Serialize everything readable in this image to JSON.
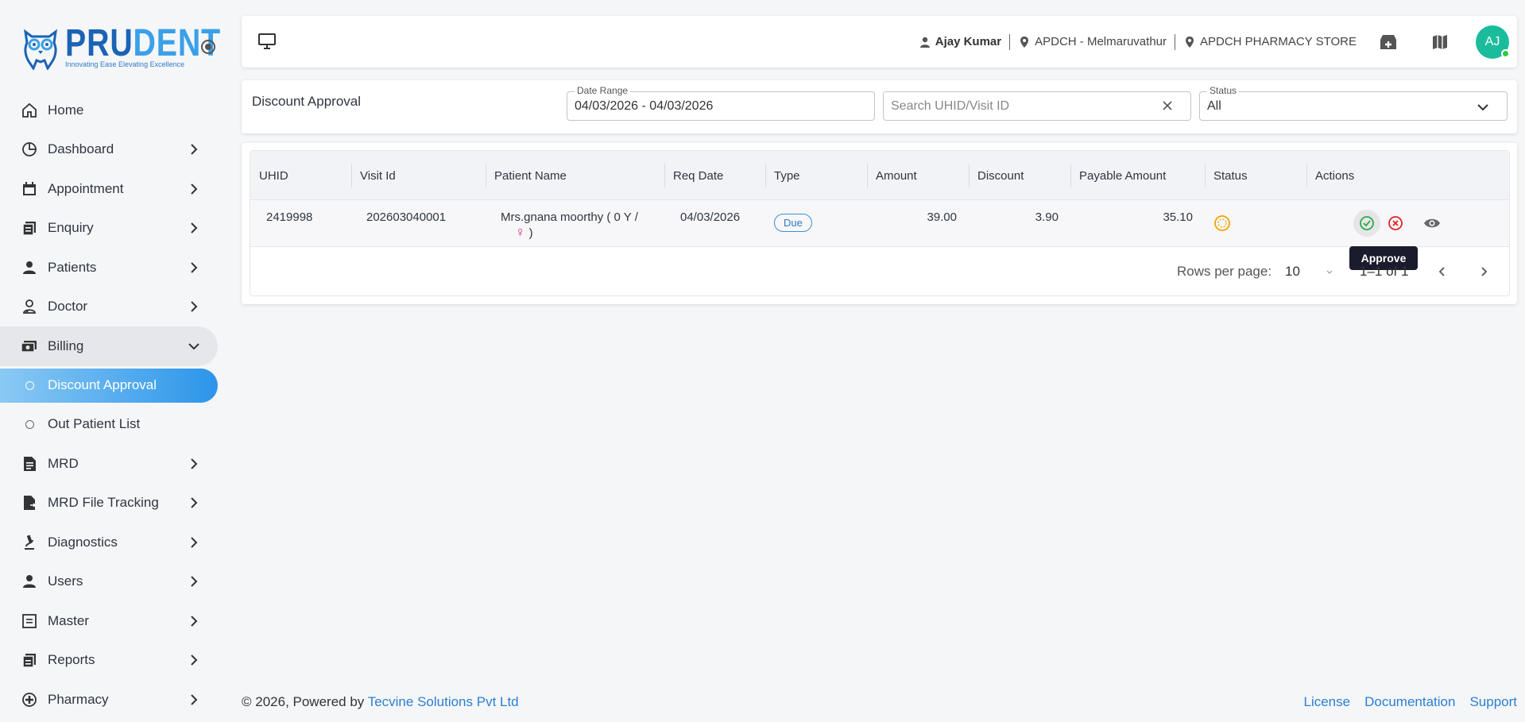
{
  "brand": {
    "part1": "PRU",
    "part2": "DENT",
    "tagline": "Innovating Ease Elevating Excellence"
  },
  "sidebar": {
    "items": [
      {
        "label": "Home",
        "icon": "home-icon"
      },
      {
        "label": "Dashboard",
        "icon": "pie-chart-icon"
      },
      {
        "label": "Appointment",
        "icon": "calendar-icon"
      },
      {
        "label": "Enquiry",
        "icon": "document-stack-icon"
      },
      {
        "label": "Patients",
        "icon": "person-icon"
      },
      {
        "label": "Doctor",
        "icon": "doctor-icon"
      },
      {
        "label": "Billing",
        "icon": "billing-icon"
      },
      {
        "label": "MRD",
        "icon": "file-text-icon"
      },
      {
        "label": "MRD File Tracking",
        "icon": "file-tracking-icon"
      },
      {
        "label": "Diagnostics",
        "icon": "microscope-icon"
      },
      {
        "label": "Users",
        "icon": "person-icon"
      },
      {
        "label": "Master",
        "icon": "list-box-icon"
      },
      {
        "label": "Reports",
        "icon": "report-icon"
      },
      {
        "label": "Pharmacy",
        "icon": "pharmacy-icon"
      }
    ],
    "billing_sub": [
      {
        "label": "Discount Approval"
      },
      {
        "label": "Out Patient List"
      }
    ]
  },
  "topbar": {
    "user": "Ajay Kumar",
    "location": "APDCH - Melmaruvathur",
    "store": "APDCH PHARMACY STORE",
    "avatar_initials": "AJ"
  },
  "filters": {
    "title": "Discount Approval",
    "date_label": "Date Range",
    "date_value": "04/03/2026 - 04/03/2026",
    "search_placeholder": "Search UHID/Visit ID",
    "status_label": "Status",
    "status_value": "All"
  },
  "table": {
    "headers": [
      "UHID",
      "Visit Id",
      "Patient Name",
      "Req Date",
      "Type",
      "Amount",
      "Discount",
      "Payable Amount",
      "Status",
      "Actions"
    ],
    "rows": [
      {
        "uhid": "2419998",
        "visit_id": "202603040001",
        "patient_name_1": "Mrs.gnana moorthy ( 0 Y /",
        "gender_symbol": "♀",
        "patient_name_2": ")",
        "req_date": "04/03/2026",
        "type": "Due",
        "amount": "39.00",
        "discount": "3.90",
        "payable": "35.10"
      }
    ],
    "tooltip": "Approve",
    "rows_per_page_label": "Rows per page:",
    "rows_per_page": "10",
    "range": "1–1 of 1"
  },
  "footer": {
    "copyright": "© 2026, Powered by ",
    "company": "Tecvine Solutions Pvt Ltd",
    "links": [
      "License",
      "Documentation",
      "Support"
    ]
  },
  "colors": {
    "accent": "#2c95ea",
    "brand_dark": "#1b63b5",
    "avatar": "#1abc9c"
  }
}
